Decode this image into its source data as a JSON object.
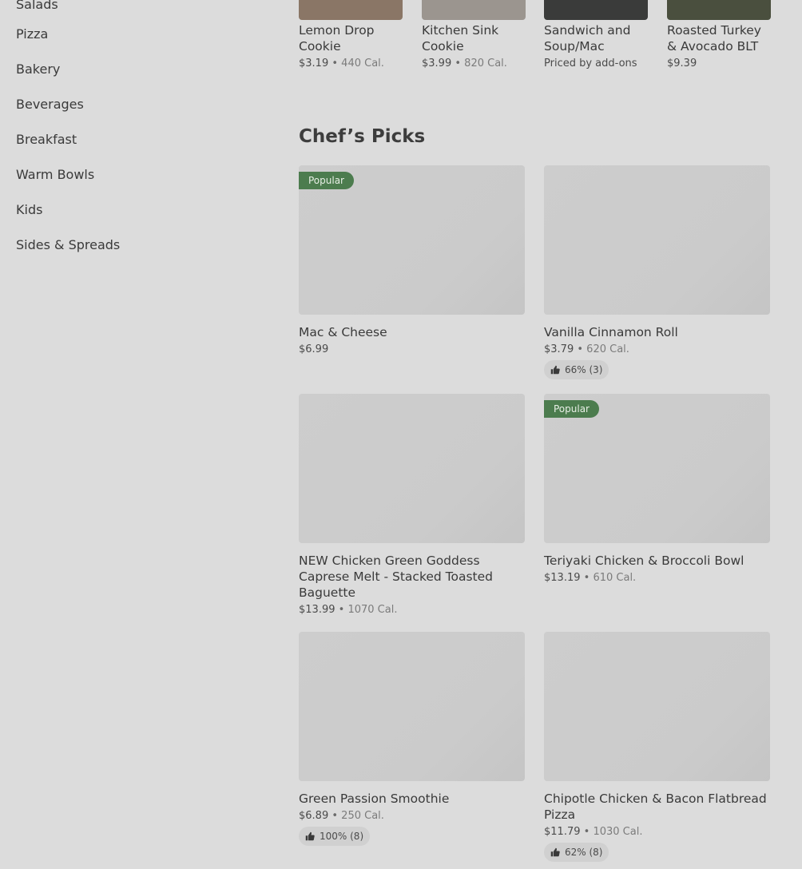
{
  "sidebar": {
    "items": [
      {
        "label": "Salads"
      },
      {
        "label": "Pizza"
      },
      {
        "label": "Bakery"
      },
      {
        "label": "Beverages"
      },
      {
        "label": "Breakfast"
      },
      {
        "label": "Warm Bowls"
      },
      {
        "label": "Kids"
      },
      {
        "label": "Sides & Spreads"
      }
    ]
  },
  "top_items": [
    {
      "name": "Lemon Drop Cookie",
      "price": "$3.19",
      "calories": "440 Cal.",
      "thumb_color": "#8a7666"
    },
    {
      "name": "Kitchen Sink Cookie",
      "price": "$3.99",
      "calories": "820 Cal.",
      "thumb_color": "#9b958f"
    },
    {
      "name": "Sandwich and Soup/Mac",
      "price_note": "Priced by add-ons",
      "thumb_color": "#3a3b3a"
    },
    {
      "name": "Roasted Turkey & Avocado BLT",
      "price": "$9.39",
      "thumb_color": "#4a4f3e"
    }
  ],
  "chefs_picks": {
    "title": "Chef’s Picks",
    "items": [
      {
        "name": "Mac & Cheese",
        "price": "$6.99",
        "badge": "Popular"
      },
      {
        "name": "Vanilla Cinnamon Roll",
        "price": "$3.79",
        "calories": "620 Cal.",
        "rating": "66% (3)"
      },
      {
        "name": "NEW Chicken Green Goddess Caprese Melt - Stacked Toasted Baguette",
        "price": "$13.99",
        "calories": "1070 Cal."
      },
      {
        "name": "Teriyaki Chicken & Broccoli Bowl",
        "price": "$13.19",
        "calories": "610 Cal.",
        "badge": "Popular"
      },
      {
        "name": "Green Passion Smoothie",
        "price": "$6.89",
        "calories": "250 Cal.",
        "rating": "100% (8)"
      },
      {
        "name": "Chipotle Chicken & Bacon Flatbread Pizza",
        "price": "$11.79",
        "calories": "1030 Cal.",
        "rating": "62% (8)"
      }
    ]
  },
  "separator": "•",
  "icons": {
    "rating": "thumbs-up-icon"
  }
}
